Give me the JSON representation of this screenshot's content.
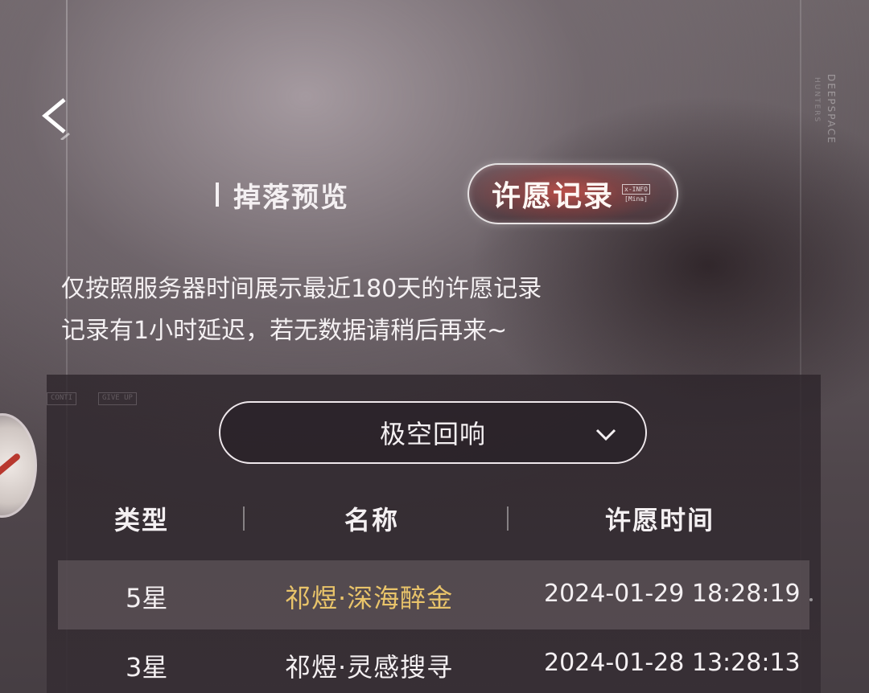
{
  "brand": {
    "name": "DEEPSPACE",
    "sub": "HUNTERS"
  },
  "tabs": [
    {
      "label": "掉落预览",
      "active": false
    },
    {
      "label": "许愿记录",
      "active": true,
      "tag_line1": "x-INFO",
      "tag_line2": "[Mina]"
    }
  ],
  "notice": {
    "line1": "仅按照服务器时间展示最近180天的许愿记录",
    "line2": "记录有1小时延迟，若无数据请稍后再来~"
  },
  "background_doc": {
    "chip1": "CONTI",
    "chip2": "GIVE UP"
  },
  "pool_select": {
    "value": "极空回响"
  },
  "table": {
    "headers": {
      "type": "类型",
      "name": "名称",
      "time": "许愿时间"
    },
    "rows": [
      {
        "type": "5星",
        "name": "祁煜·深海醉金",
        "time": "2024-01-29 18:28:19",
        "highlight": true,
        "name_color": "#e9c46a"
      },
      {
        "type": "3星",
        "name": "祁煜·灵感搜寻",
        "time": "2024-01-28 13:28:13",
        "highlight": false,
        "name_color": "#f4f0f2"
      }
    ]
  },
  "icons": {
    "back": "back-arrow-icon",
    "dropdown": "chevron-down-icon"
  }
}
